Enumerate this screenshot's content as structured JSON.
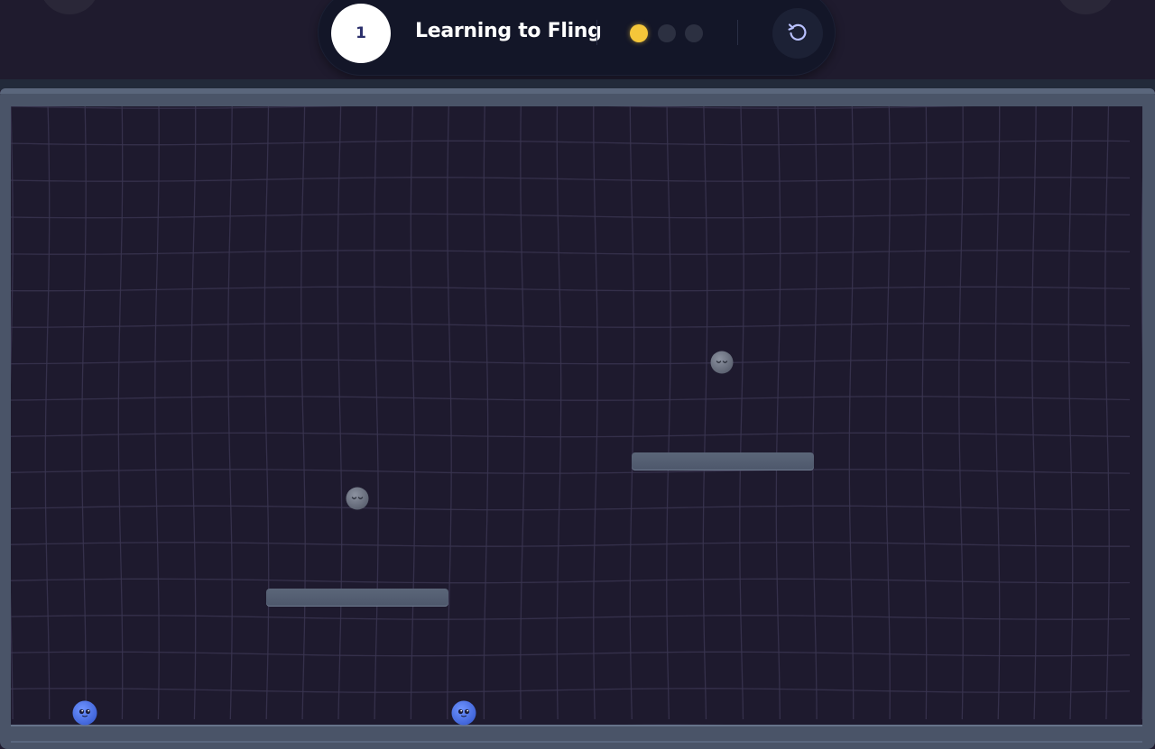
{
  "header": {
    "level_number": "1",
    "level_title": "Learning to Fling",
    "progress_dots": [
      {
        "state": "active",
        "color": "#f4c63a"
      },
      {
        "state": "inactive",
        "color": "#2c3041"
      },
      {
        "state": "inactive",
        "color": "#2c3041"
      }
    ],
    "restart_icon": "restart-icon"
  },
  "arena": {
    "colors": {
      "background": "#1e1a2e",
      "grid_line": "#3a3550",
      "frame": "#4a5468",
      "platform": "#535d70"
    },
    "platforms": [
      {
        "name": "upper-right-platform"
      },
      {
        "name": "lower-left-platform"
      }
    ],
    "targets": [
      {
        "name": "sleeping-target-upper",
        "face": "sleeping-face-icon",
        "color": "#6c7280"
      },
      {
        "name": "sleeping-target-lower",
        "face": "sleeping-face-icon",
        "color": "#6c7280"
      }
    ],
    "players": [
      {
        "name": "blue-ball-left",
        "face": "happy-face-icon",
        "color": "#4e78f0"
      },
      {
        "name": "blue-ball-right",
        "face": "happy-face-icon",
        "color": "#4e78f0"
      }
    ]
  }
}
